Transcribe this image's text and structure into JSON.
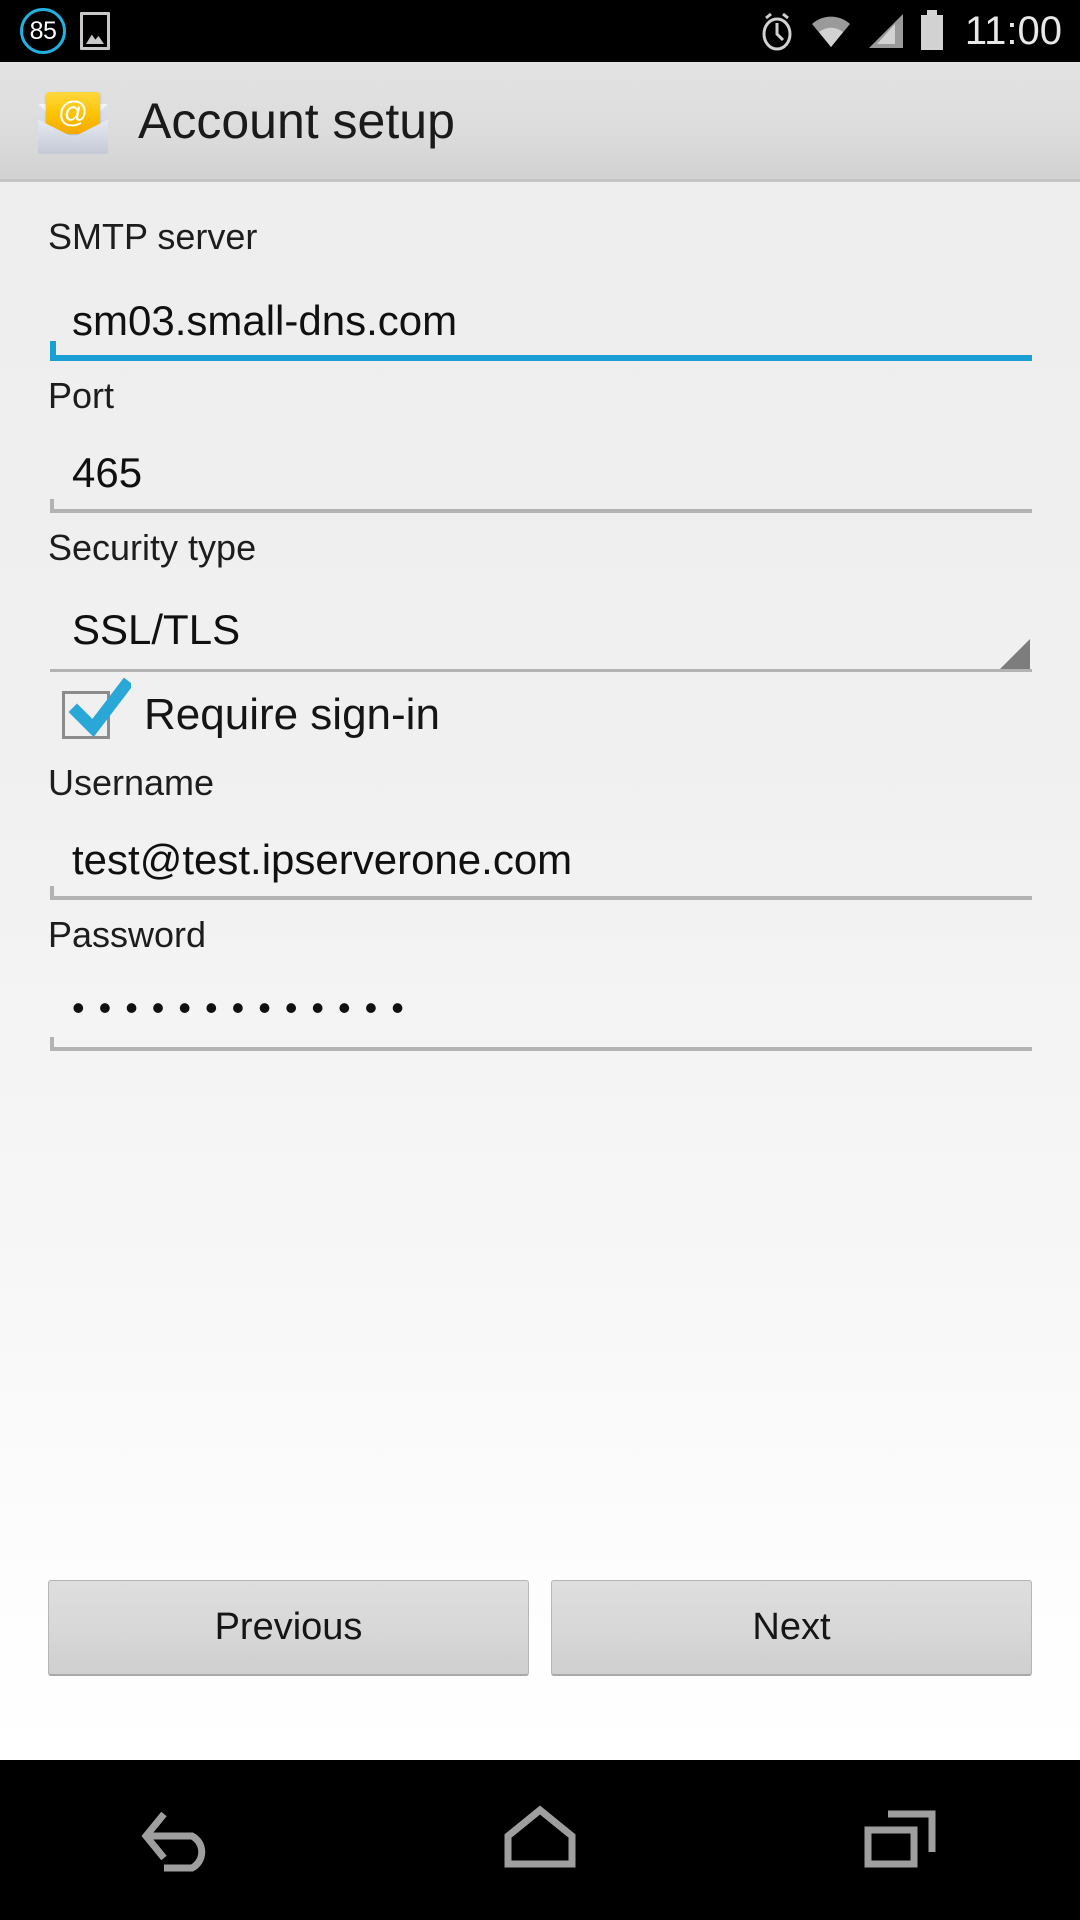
{
  "status_bar": {
    "notification_badge": "85",
    "notification_icon": "image-thumbnail-icon",
    "alarm_icon": "alarm-clock-icon",
    "wifi_icon": "wifi-icon",
    "signal_icon": "cellular-signal-icon",
    "battery_icon": "battery-full-icon",
    "time": "11:00",
    "accent_color": "#21b0e0"
  },
  "action_bar": {
    "icon": "email-setup-icon",
    "icon_glyph": "@",
    "title": "Account setup"
  },
  "form": {
    "smtp_server": {
      "label": "SMTP server",
      "value": "sm03.small-dns.com",
      "focused": true,
      "focus_color": "#1a9fd4"
    },
    "port": {
      "label": "Port",
      "value": "465",
      "focused": false
    },
    "security_type": {
      "label": "Security type",
      "value": "SSL/TLS",
      "dropdown_icon": "spinner-triangle-icon"
    },
    "require_signin": {
      "label": "Require sign-in",
      "checked": true,
      "check_color": "#29a8d8"
    },
    "username": {
      "label": "Username",
      "value": "test@test.ipserverone.com",
      "focused": false
    },
    "password": {
      "label": "Password",
      "value": "•••••••••••••",
      "masked": true,
      "focused": false
    }
  },
  "buttons": {
    "previous": "Previous",
    "next": "Next"
  },
  "nav_bar": {
    "back": "back-icon",
    "home": "home-icon",
    "recents": "recents-icon"
  }
}
